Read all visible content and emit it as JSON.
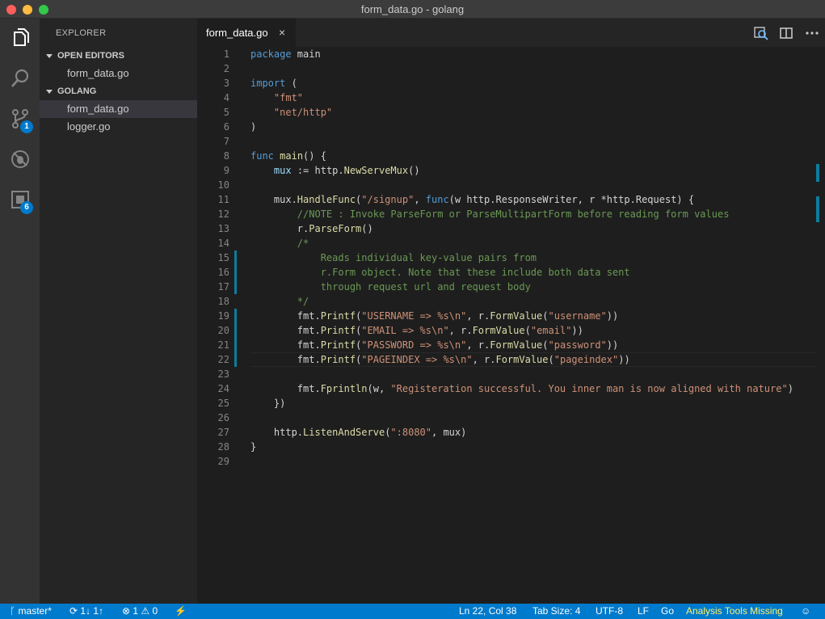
{
  "window": {
    "title": "form_data.go - golang"
  },
  "activity_bar": {
    "scm_badge": "1",
    "extensions_badge": "6"
  },
  "sidebar": {
    "header": "EXPLORER",
    "open_editors_label": "OPEN EDITORS",
    "open_editors": [
      "form_data.go"
    ],
    "folder_label": "GOLANG",
    "files": [
      "form_data.go",
      "logger.go"
    ]
  },
  "tabs": [
    {
      "label": "form_data.go",
      "close": "×"
    }
  ],
  "editor": {
    "cursor_line": 22,
    "modified_lines": [
      15,
      16,
      17,
      19,
      20,
      21,
      22
    ],
    "lines": [
      {
        "n": "1",
        "tokens": [
          [
            "kw",
            "package"
          ],
          [
            "op",
            " main"
          ]
        ]
      },
      {
        "n": "2",
        "tokens": []
      },
      {
        "n": "3",
        "tokens": [
          [
            "kw",
            "import"
          ],
          [
            "op",
            " ("
          ]
        ]
      },
      {
        "n": "4",
        "tokens": [
          [
            "op",
            "    "
          ],
          [
            "str",
            "\"fmt\""
          ]
        ]
      },
      {
        "n": "5",
        "tokens": [
          [
            "op",
            "    "
          ],
          [
            "str",
            "\"net/http\""
          ]
        ]
      },
      {
        "n": "6",
        "tokens": [
          [
            "op",
            ")"
          ]
        ]
      },
      {
        "n": "7",
        "tokens": []
      },
      {
        "n": "8",
        "tokens": [
          [
            "kw",
            "func"
          ],
          [
            "op",
            " "
          ],
          [
            "fn",
            "main"
          ],
          [
            "op",
            "() {"
          ]
        ]
      },
      {
        "n": "9",
        "tokens": [
          [
            "op",
            "    "
          ],
          [
            "var",
            "mux"
          ],
          [
            "op",
            " := http."
          ],
          [
            "fn",
            "NewServeMux"
          ],
          [
            "op",
            "()"
          ]
        ]
      },
      {
        "n": "10",
        "tokens": []
      },
      {
        "n": "11",
        "tokens": [
          [
            "op",
            "    mux."
          ],
          [
            "fn",
            "HandleFunc"
          ],
          [
            "op",
            "("
          ],
          [
            "str",
            "\"/signup\""
          ],
          [
            "op",
            ", "
          ],
          [
            "kw",
            "func"
          ],
          [
            "op",
            "(w http.ResponseWriter, r *http.Request) {"
          ]
        ]
      },
      {
        "n": "12",
        "tokens": [
          [
            "op",
            "        "
          ],
          [
            "cm",
            "//NOTE : Invoke ParseForm or ParseMultipartForm before reading form values"
          ]
        ]
      },
      {
        "n": "13",
        "tokens": [
          [
            "op",
            "        r."
          ],
          [
            "fn",
            "ParseForm"
          ],
          [
            "op",
            "()"
          ]
        ]
      },
      {
        "n": "14",
        "tokens": [
          [
            "op",
            "        "
          ],
          [
            "cm",
            "/*"
          ]
        ]
      },
      {
        "n": "15",
        "tokens": [
          [
            "op",
            "            "
          ],
          [
            "cm",
            "Reads individual key-value pairs from"
          ]
        ]
      },
      {
        "n": "16",
        "tokens": [
          [
            "op",
            "            "
          ],
          [
            "cm",
            "r.Form object. Note that these include both data sent"
          ]
        ]
      },
      {
        "n": "17",
        "tokens": [
          [
            "op",
            "            "
          ],
          [
            "cm",
            "through request url and request body"
          ]
        ]
      },
      {
        "n": "18",
        "tokens": [
          [
            "op",
            "        "
          ],
          [
            "cm",
            "*/"
          ]
        ]
      },
      {
        "n": "19",
        "tokens": [
          [
            "op",
            "        fmt."
          ],
          [
            "fn",
            "Printf"
          ],
          [
            "op",
            "("
          ],
          [
            "str",
            "\"USERNAME => %s\\n\""
          ],
          [
            "op",
            ", r."
          ],
          [
            "fn",
            "FormValue"
          ],
          [
            "op",
            "("
          ],
          [
            "str",
            "\"username\""
          ],
          [
            "op",
            "))"
          ]
        ]
      },
      {
        "n": "20",
        "tokens": [
          [
            "op",
            "        fmt."
          ],
          [
            "fn",
            "Printf"
          ],
          [
            "op",
            "("
          ],
          [
            "str",
            "\"EMAIL => %s\\n\""
          ],
          [
            "op",
            ", r."
          ],
          [
            "fn",
            "FormValue"
          ],
          [
            "op",
            "("
          ],
          [
            "str",
            "\"email\""
          ],
          [
            "op",
            "))"
          ]
        ]
      },
      {
        "n": "21",
        "tokens": [
          [
            "op",
            "        fmt."
          ],
          [
            "fn",
            "Printf"
          ],
          [
            "op",
            "("
          ],
          [
            "str",
            "\"PASSWORD => %s\\n\""
          ],
          [
            "op",
            ", r."
          ],
          [
            "fn",
            "FormValue"
          ],
          [
            "op",
            "("
          ],
          [
            "str",
            "\"password\""
          ],
          [
            "op",
            "))"
          ]
        ]
      },
      {
        "n": "22",
        "tokens": [
          [
            "op",
            "        fmt."
          ],
          [
            "fn",
            "Printf"
          ],
          [
            "op",
            "("
          ],
          [
            "str",
            "\"PAGEINDEX => %s\\n\""
          ],
          [
            "op",
            ", r."
          ],
          [
            "fn",
            "FormValue"
          ],
          [
            "op",
            "("
          ],
          [
            "str",
            "\"pageindex\""
          ],
          [
            "op",
            "))"
          ]
        ]
      },
      {
        "n": "23",
        "tokens": []
      },
      {
        "n": "24",
        "tokens": [
          [
            "op",
            "        fmt."
          ],
          [
            "fn",
            "Fprintln"
          ],
          [
            "op",
            "(w, "
          ],
          [
            "str",
            "\"Registeration successful. You inner man is now aligned with nature\""
          ],
          [
            "op",
            ")"
          ]
        ]
      },
      {
        "n": "25",
        "tokens": [
          [
            "op",
            "    })"
          ]
        ]
      },
      {
        "n": "26",
        "tokens": []
      },
      {
        "n": "27",
        "tokens": [
          [
            "op",
            "    http."
          ],
          [
            "fn",
            "ListenAndServe"
          ],
          [
            "op",
            "("
          ],
          [
            "str",
            "\":8080\""
          ],
          [
            "op",
            ", mux)"
          ]
        ]
      },
      {
        "n": "28",
        "tokens": [
          [
            "op",
            "}"
          ]
        ]
      },
      {
        "n": "29",
        "tokens": []
      }
    ]
  },
  "status": {
    "branch": "master*",
    "sync": "1↓ 1↑",
    "errors": "1",
    "warnings": "0",
    "position": "Ln 22, Col 38",
    "tab_size": "Tab Size: 4",
    "encoding": "UTF-8",
    "eol": "LF",
    "language": "Go",
    "analysis": "Analysis Tools Missing"
  },
  "icons": {
    "activity": [
      "files-icon",
      "search-icon",
      "source-control-icon",
      "debug-icon",
      "extensions-icon"
    ],
    "tab_actions": [
      "open-preview-icon",
      "split-editor-icon",
      "more-actions-icon"
    ]
  },
  "colors": {
    "accent": "#007acc",
    "warning_text": "#fff26b",
    "keyword": "#569cd6",
    "string": "#ce9178",
    "comment": "#6a9955",
    "function": "#dcdcaa",
    "variable": "#9cdcfe"
  }
}
